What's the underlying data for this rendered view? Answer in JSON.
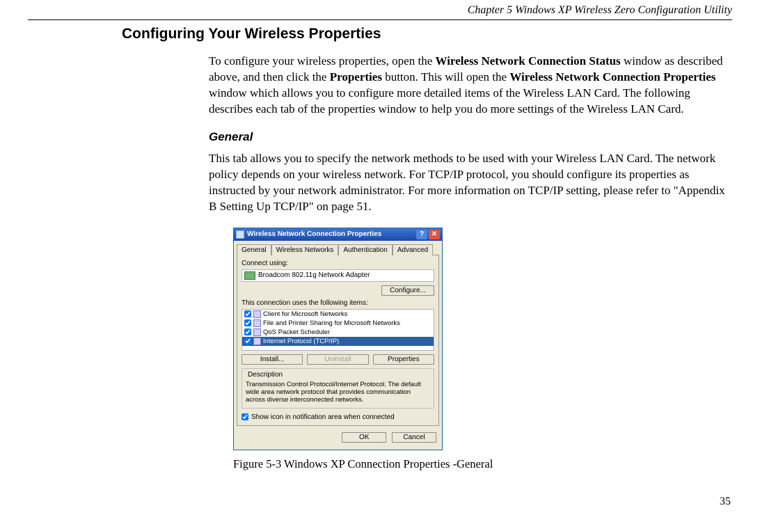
{
  "header": {
    "chapter": "Chapter 5    Windows XP Wireless Zero Configuration Utility"
  },
  "heading": "Configuring Your Wireless Properties",
  "para1": {
    "p1a": "To configure your wireless properties, open the ",
    "p1b": "Wireless Network Connection Status",
    "p1c": " window as described above, and then click the ",
    "p1d": "Properties",
    "p1e": " button. This will open the ",
    "p1f": "Wireless Network Connection Properties",
    "p1g": " window which allows you to configure more detailed items of the Wireless LAN Card. The following describes each tab of the properties window to help you do more settings of the Wireless LAN Card."
  },
  "subheading": "General",
  "para2": "This tab allows you to specify the network methods to be used with your Wireless LAN Card. The network policy depends on your wireless network. For TCP/IP protocol, you should configure its properties as instructed by your network administrator. For more information on TCP/IP setting, please refer to \"Appendix B    Setting Up TCP/IP\" on page 51.",
  "dialog": {
    "title": "Wireless Network Connection Properties",
    "tabs": [
      "General",
      "Wireless Networks",
      "Authentication",
      "Advanced"
    ],
    "connect_label": "Connect using:",
    "adapter": "Broadcom 802.11g Network Adapter",
    "configure_btn": "Configure...",
    "items_label": "This connection uses the following items:",
    "items": [
      "Client for Microsoft Networks",
      "File and Printer Sharing for Microsoft Networks",
      "QoS Packet Scheduler",
      "Internet Protocol (TCP/IP)"
    ],
    "install_btn": "Install...",
    "uninstall_btn": "Uninstall",
    "properties_btn": "Properties",
    "desc_label": "Description",
    "desc_text": "Transmission Control Protocol/Internet Protocol. The default wide area network protocol that provides communication across diverse interconnected networks.",
    "showicon": "Show icon in notification area when connected",
    "ok_btn": "OK",
    "cancel_btn": "Cancel"
  },
  "caption": "Figure 5-3    Windows XP Connection Properties -General",
  "page_number": "35"
}
